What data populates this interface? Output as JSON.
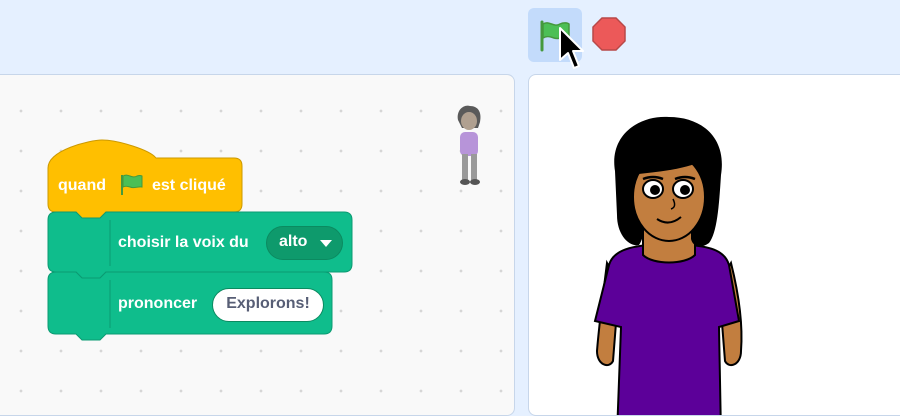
{
  "toolbar": {
    "green_flag_icon": "green-flag-icon",
    "stop_icon": "stop-sign-icon",
    "green_flag_color": "#4cbf56",
    "stop_color": "#ec5959"
  },
  "blocks": {
    "hat": {
      "label_before": "quand",
      "flag_icon": "green-flag-icon",
      "label_after": "est cliqué",
      "color": "#ffbf00"
    },
    "voice": {
      "label": "choisir la voix du",
      "dropdown_value": "alto",
      "color": "#0fbd8c"
    },
    "speak": {
      "label": "prononcer",
      "text_value": "Explorons!",
      "color": "#0fbd8c"
    }
  },
  "colors": {
    "workspace_bg": "#f9f9f9",
    "gui_bg": "#e5f0ff",
    "flag_button_active": "#c3dbfb"
  }
}
